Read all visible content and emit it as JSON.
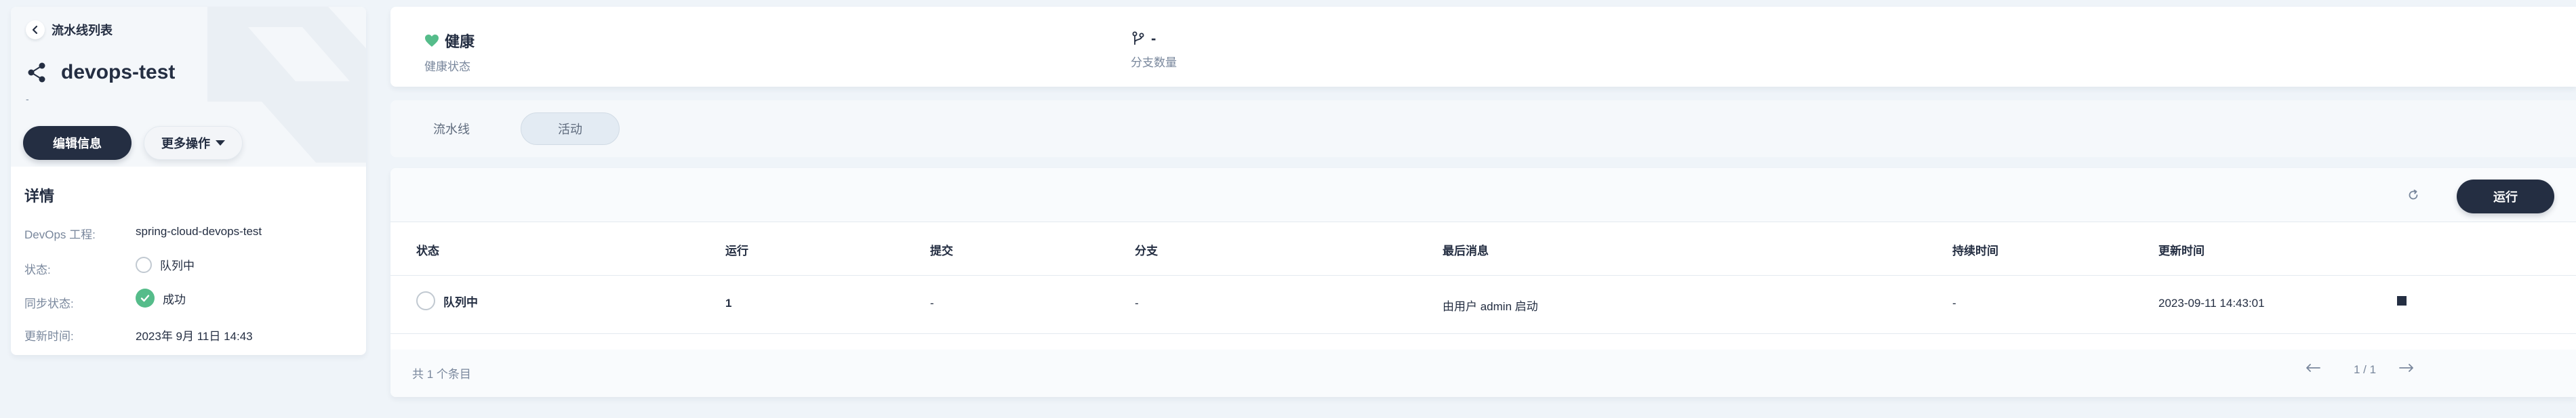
{
  "sidebar": {
    "back_label": "流水线列表",
    "title": "devops-test",
    "description": "-",
    "edit_button": "编辑信息",
    "more_button": "更多操作",
    "details_title": "详情",
    "details": [
      {
        "label": "DevOps 工程:",
        "value": "spring-cloud-devops-test"
      },
      {
        "label": "状态:",
        "value": "队列中"
      },
      {
        "label": "同步状态:",
        "value": "成功"
      },
      {
        "label": "更新时间:",
        "value": "2023年 9月 11日 14:43"
      }
    ]
  },
  "status": {
    "health_value": "健康",
    "health_label": "健康状态",
    "branch_value": "-",
    "branch_label": "分支数量"
  },
  "tabs": [
    {
      "label": "流水线",
      "active": false
    },
    {
      "label": "活动",
      "active": true
    }
  ],
  "toolbar": {
    "run_button": "运行"
  },
  "table": {
    "headers": [
      "状态",
      "运行",
      "提交",
      "分支",
      "最后消息",
      "持续时间",
      "更新时间"
    ],
    "rows": [
      {
        "status": "队列中",
        "run": "1",
        "commit": "-",
        "branch": "-",
        "message": "由用户 admin 启动",
        "duration": "-",
        "updated": "2023-09-11 14:43:01"
      }
    ],
    "total": "共 1 个条目",
    "page": "1 / 1"
  },
  "colors": {
    "dark": "#242e42",
    "muted": "#79879c",
    "success": "#55bc8a",
    "background": "#eff4f9"
  }
}
